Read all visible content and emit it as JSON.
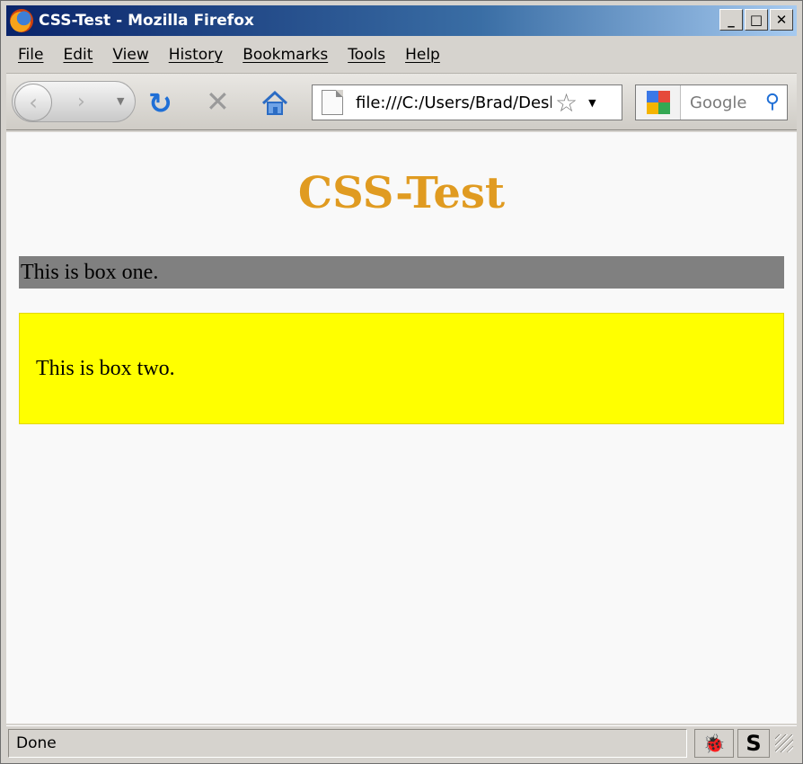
{
  "window": {
    "title": "CSS-Test - Mozilla Firefox"
  },
  "window_buttons": {
    "minimize": "_",
    "maximize": "□",
    "close": "✕"
  },
  "menu": [
    "File",
    "Edit",
    "View",
    "History",
    "Bookmarks",
    "Tools",
    "Help"
  ],
  "navbar": {
    "url": "file:///C:/Users/Brad/Desktop/css-test.html",
    "search_placeholder": "Google"
  },
  "page": {
    "heading": "CSS-Test",
    "box_one": "This is box one.",
    "box_two": "This is box two."
  },
  "status": {
    "text": "Done"
  },
  "colors": {
    "heading": "#e09b21",
    "box_one_bg": "#808080",
    "box_two_bg": "#ffff00",
    "titlebar_start": "#0a246a"
  },
  "icons": [
    "firefox-logo-icon",
    "back-icon",
    "forward-icon",
    "reload-icon",
    "stop-icon",
    "home-icon",
    "page-icon",
    "star-icon",
    "google-icon",
    "search-icon",
    "bug-icon",
    "s-icon"
  ]
}
